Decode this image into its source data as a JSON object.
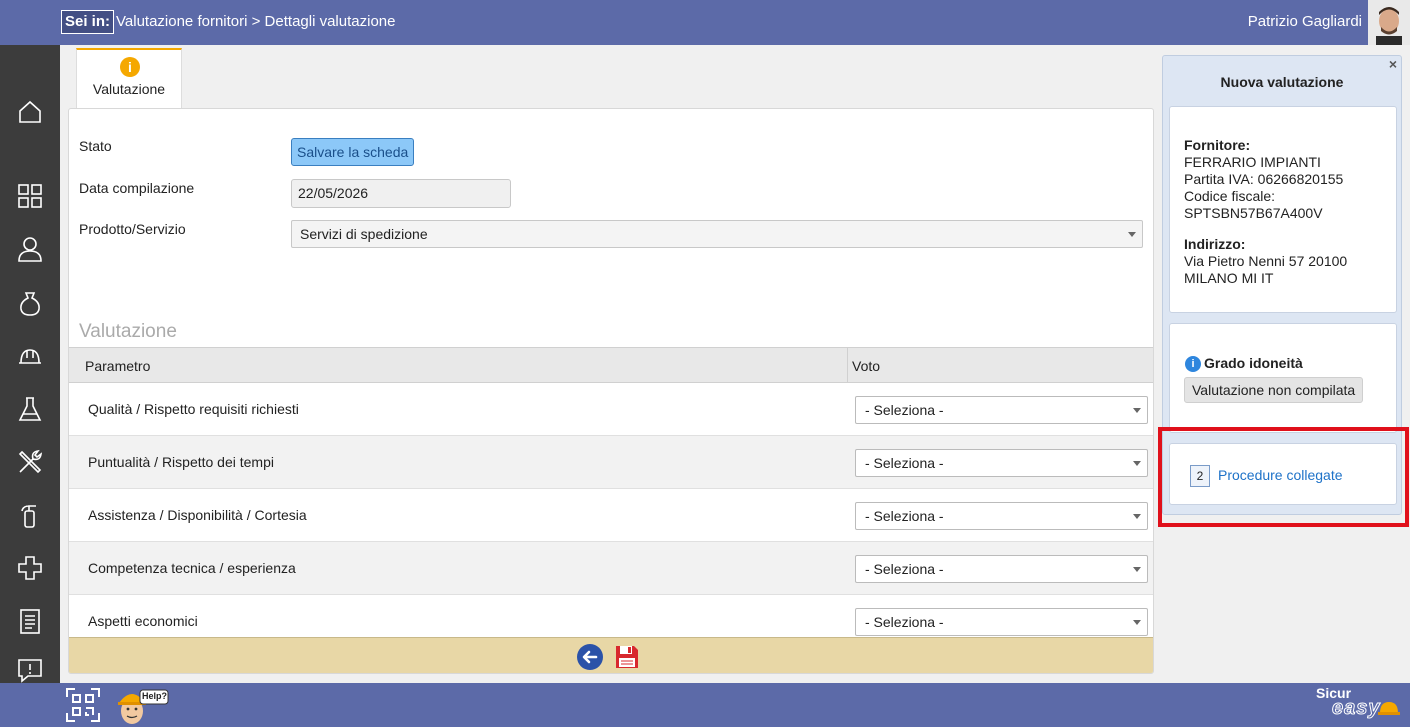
{
  "header": {
    "sei_in_label": "Sei in:",
    "breadcrumb": "Valutazione fornitori > Dettagli valutazione",
    "user_name": "Patrizio Gagliardi"
  },
  "sidebar": {
    "items": [
      {
        "icon": "home-icon"
      },
      {
        "icon": "grid-icon"
      },
      {
        "icon": "user-icon"
      },
      {
        "icon": "bag-icon"
      },
      {
        "icon": "hardhat-icon"
      },
      {
        "icon": "flask-icon"
      },
      {
        "icon": "tools-icon"
      },
      {
        "icon": "fire-extinguisher-icon"
      },
      {
        "icon": "medical-cross-icon"
      },
      {
        "icon": "document-icon"
      },
      {
        "icon": "alert-icon"
      }
    ]
  },
  "tabs": [
    {
      "label": "Valutazione",
      "icon": "info-icon",
      "active": true
    }
  ],
  "form": {
    "stato_label": "Stato",
    "stato_button": "Salvare la scheda",
    "data_label": "Data compilazione",
    "data_value": "22/05/2026",
    "prodotto_label": "Prodotto/Servizio",
    "prodotto_value": "Servizi di spedizione"
  },
  "evaluation": {
    "title": "Valutazione",
    "col_param": "Parametro",
    "col_voto": "Voto",
    "rows": [
      {
        "param": "Qualità / Rispetto requisiti richiesti",
        "voto": "- Seleziona -"
      },
      {
        "param": "Puntualità / Rispetto dei tempi",
        "voto": "- Seleziona -"
      },
      {
        "param": "Assistenza / Disponibilità / Cortesia",
        "voto": "- Seleziona -"
      },
      {
        "param": "Competenza tecnica / esperienza",
        "voto": "- Seleziona -"
      },
      {
        "param": "Aspetti economici",
        "voto": "- Seleziona -"
      }
    ]
  },
  "side": {
    "close": "×",
    "title": "Nuova valutazione",
    "fornitore_label": "Fornitore:",
    "fornitore_name": "FERRARIO IMPIANTI",
    "piva": "Partita IVA: 06266820155",
    "cf_label": "Codice fiscale:",
    "cf_value": "SPTSBN57B67A400V",
    "indirizzo_label": "Indirizzo:",
    "indirizzo_line1": "Via Pietro Nenni 57 20100",
    "indirizzo_line2": "MILANO MI IT",
    "grado_label": "Grado idoneità",
    "grado_value": "Valutazione non compilata",
    "proc_count": "2",
    "proc_label": "Procedure collegate"
  },
  "bottom": {
    "help_label": "Help?",
    "logo_top": "Sicur",
    "logo_bottom": "easy"
  },
  "colors": {
    "header_bg": "#5c6aa8",
    "sidebar_bg": "#3c3c3c",
    "tab_accent": "#f5a800",
    "footer_bar": "#e8d7a6",
    "highlight": "#e0101b",
    "link": "#1e72c8"
  }
}
